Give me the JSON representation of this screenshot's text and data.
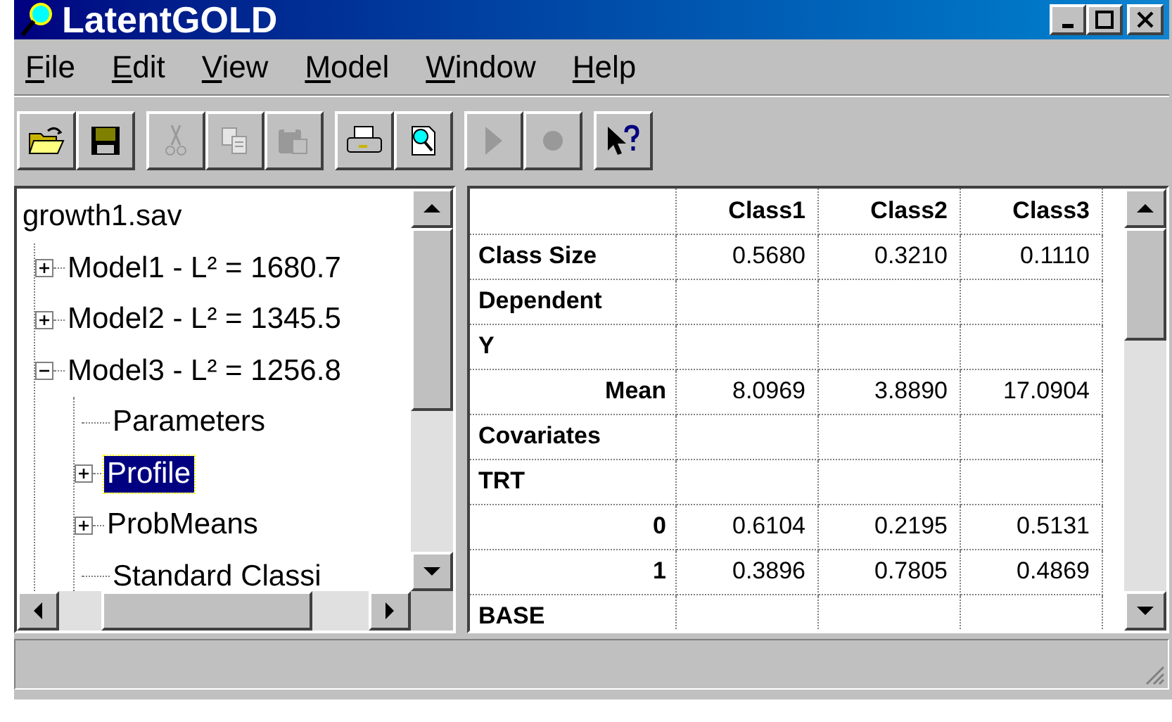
{
  "window": {
    "title": "LatentGOLD"
  },
  "menu": [
    {
      "label": "File"
    },
    {
      "label": "Edit"
    },
    {
      "label": "View"
    },
    {
      "label": "Model"
    },
    {
      "label": "Window"
    },
    {
      "label": "Help"
    }
  ],
  "toolbar": [
    [
      {
        "kind": "open",
        "disabled": false
      },
      {
        "kind": "save",
        "disabled": false
      }
    ],
    [
      {
        "kind": "cut",
        "disabled": true
      },
      {
        "kind": "copy",
        "disabled": true
      },
      {
        "kind": "paste",
        "disabled": true
      }
    ],
    [
      {
        "kind": "print",
        "disabled": false
      },
      {
        "kind": "preview",
        "disabled": false
      }
    ],
    [
      {
        "kind": "play",
        "disabled": true
      },
      {
        "kind": "stop",
        "disabled": true
      }
    ],
    [
      {
        "kind": "help",
        "disabled": false
      }
    ]
  ],
  "tree": [
    {
      "label": "growth1.sav",
      "kind": "root",
      "children": [
        {
          "label": "Model1 - L² = 1680.7",
          "kind": "folder",
          "expanded": false,
          "selected": false
        },
        {
          "label": "Model2 - L² = 1345.5",
          "kind": "folder",
          "expanded": false,
          "selected": false
        },
        {
          "label": "Model3 - L² = 1256.8",
          "kind": "folder",
          "expanded": true,
          "selected": false,
          "children": [
            {
              "label": "Parameters",
              "kind": "leaf",
              "selected": false
            },
            {
              "label": "Profile",
              "kind": "folder",
              "expanded": false,
              "selected": true
            },
            {
              "label": "ProbMeans",
              "kind": "folder",
              "expanded": false,
              "selected": false
            },
            {
              "label": "Standard Classi",
              "kind": "leaf",
              "selected": false
            }
          ]
        }
      ]
    }
  ],
  "table": {
    "columns": [
      "Class1",
      "Class2",
      "Class3"
    ],
    "rows": [
      {
        "label": "Class Size",
        "kind": "heading",
        "cells": [
          "0.5680",
          "0.3210",
          "0.1110"
        ]
      },
      {
        "label": "Dependent",
        "kind": "heading",
        "cells": []
      },
      {
        "label": "Y",
        "kind": "heading",
        "cells": []
      },
      {
        "label": "Mean",
        "kind": "level",
        "cells": [
          "8.0969",
          "3.8890",
          "17.0904"
        ]
      },
      {
        "label": "Covariates",
        "kind": "heading",
        "cells": []
      },
      {
        "label": "TRT",
        "kind": "heading",
        "cells": []
      },
      {
        "label": "0",
        "kind": "level",
        "cells": [
          "0.6104",
          "0.2195",
          "0.5131"
        ]
      },
      {
        "label": "1",
        "kind": "level",
        "cells": [
          "0.3896",
          "0.7805",
          "0.4869"
        ]
      },
      {
        "label": "BASE",
        "kind": "heading",
        "cells": []
      }
    ]
  }
}
